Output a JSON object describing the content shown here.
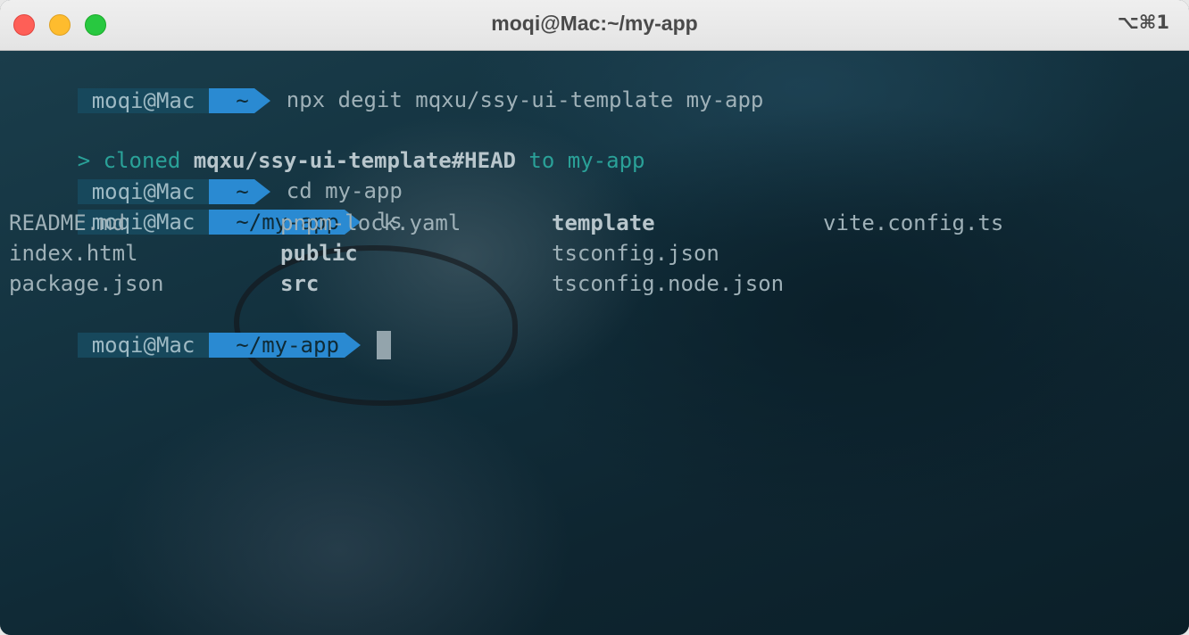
{
  "window": {
    "title": "moqi@Mac:~/my-app",
    "shortcut": "⌥⌘1"
  },
  "prompts": [
    {
      "user": "moqi@Mac",
      "dir": "~",
      "command": "npx degit mqxu/ssy-ui-template my-app"
    },
    {
      "user": "moqi@Mac",
      "dir": "~",
      "command": "cd my-app"
    },
    {
      "user": "moqi@Mac",
      "dir": "~/my-app",
      "command": "ls"
    },
    {
      "user": "moqi@Mac",
      "dir": "~/my-app",
      "command": ""
    }
  ],
  "output": {
    "cloned": {
      "prefix": "> cloned ",
      "repo": "mqxu/ssy-ui-template#HEAD",
      "to": " to my-app"
    }
  },
  "ls_files": [
    {
      "name": "README.md",
      "is_dir": false
    },
    {
      "name": "pnpm-lock.yaml",
      "is_dir": false
    },
    {
      "name": "template",
      "is_dir": true
    },
    {
      "name": "vite.config.ts",
      "is_dir": false
    },
    {
      "name": "index.html",
      "is_dir": false
    },
    {
      "name": "public",
      "is_dir": true
    },
    {
      "name": "tsconfig.json",
      "is_dir": false
    },
    {
      "name": "package.json",
      "is_dir": false
    },
    {
      "name": "src",
      "is_dir": true
    },
    {
      "name": "tsconfig.node.json",
      "is_dir": false
    }
  ],
  "colors": {
    "prompt_user_bg": "#17485c",
    "prompt_dir_bg": "#2a8ad2",
    "accent_teal": "#2aa198"
  }
}
